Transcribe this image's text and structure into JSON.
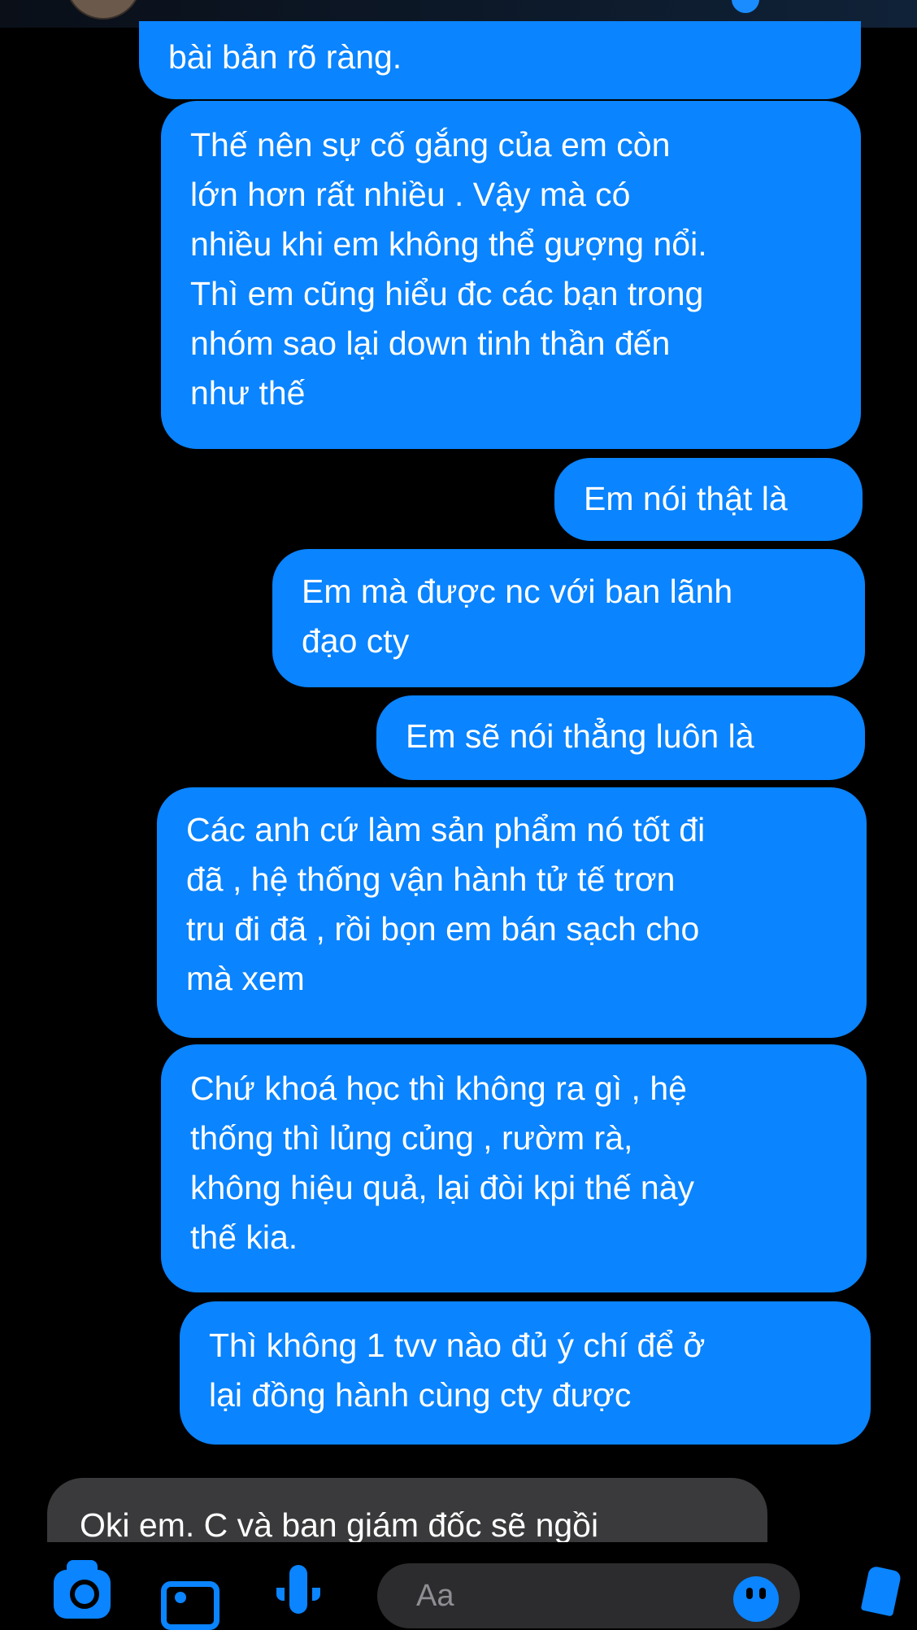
{
  "messages": [
    {
      "sender": "me",
      "text": "bài bản rõ ràng."
    },
    {
      "sender": "me",
      "text": "Thế nên sự cố gắng của em còn\nlớn hơn rất nhiều . Vậy mà có\nnhiều khi em không thể gượng nổi.\nThì em cũng hiểu đc các bạn trong\nnhóm sao lại down tinh thần đến\nnhư thế"
    },
    {
      "sender": "me",
      "text": "Em nói thật là"
    },
    {
      "sender": "me",
      "text": "Em mà được nc với ban lãnh\nđạo cty"
    },
    {
      "sender": "me",
      "text": "Em sẽ nói thẳng luôn là"
    },
    {
      "sender": "me",
      "text": "Các anh cứ làm sản phẩm nó tốt đi\nđã , hệ thống vận hành tử tế trơn\ntru đi đã , rồi bọn em bán sạch cho\nmà xem"
    },
    {
      "sender": "me",
      "text": "Chứ khoá học thì không ra gì , hệ\nthống thì lủng củng , rườm rà,\nkhông hiệu quả, lại đòi kpi thế này\nthế kia."
    },
    {
      "sender": "me",
      "text": "Thì không 1 tvv nào đủ ý chí để ở\nlại đồng hành cùng cty được"
    },
    {
      "sender": "other",
      "text": "Oki em. C và ban giám đốc sẽ ngồi"
    }
  ],
  "composer": {
    "placeholder": "Aa"
  },
  "colors": {
    "outgoing_bubble": "#0a84ff",
    "incoming_bubble": "#3a3a3c",
    "background": "#000000"
  },
  "icons": [
    "camera-icon",
    "photo-icon",
    "microphone-icon",
    "emoji-icon",
    "like-icon"
  ]
}
